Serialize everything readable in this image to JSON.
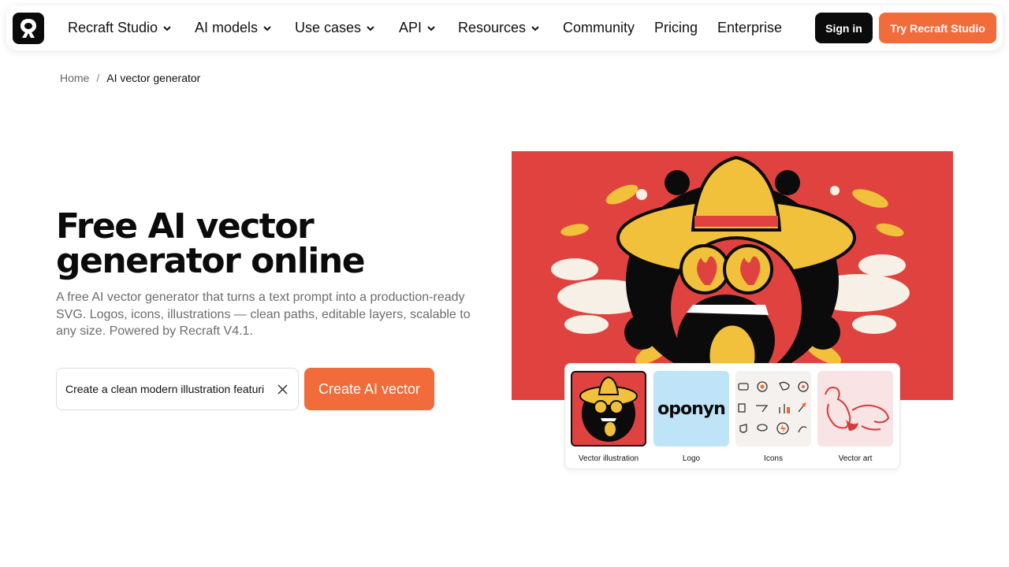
{
  "nav": {
    "items": [
      {
        "label": "Recraft Studio",
        "dropdown": true
      },
      {
        "label": "AI models",
        "dropdown": true
      },
      {
        "label": "Use cases",
        "dropdown": true
      },
      {
        "label": "API",
        "dropdown": true
      },
      {
        "label": "Resources",
        "dropdown": true
      },
      {
        "label": "Community",
        "dropdown": false
      },
      {
        "label": "Pricing",
        "dropdown": false
      },
      {
        "label": "Enterprise",
        "dropdown": false
      }
    ],
    "signin_label": "Sign in",
    "try_label": "Try Recraft Studio"
  },
  "breadcrumb": {
    "home": "Home",
    "separator": "/",
    "current": "AI vector generator"
  },
  "hero": {
    "title_line1": "Free AI vector",
    "title_line2": "generator online",
    "subtitle": "A free AI vector generator that turns a text prompt into a production-ready SVG. Logos, icons, illustrations — clean paths, editable layers, scalable to any size. Powered by Recraft V4.1.",
    "prompt_value": "Create a clean modern illustration featuri",
    "create_label": "Create AI vector"
  },
  "styles": {
    "options": [
      {
        "label": "Vector illustration",
        "selected": true
      },
      {
        "label": "Logo",
        "selected": false,
        "thumb_text": "oponyn"
      },
      {
        "label": "Icons",
        "selected": false
      },
      {
        "label": "Vector art",
        "selected": false
      }
    ]
  },
  "colors": {
    "accent": "#f26b3a",
    "art_bg": "#e0433f",
    "dark": "#0b0b0b"
  }
}
